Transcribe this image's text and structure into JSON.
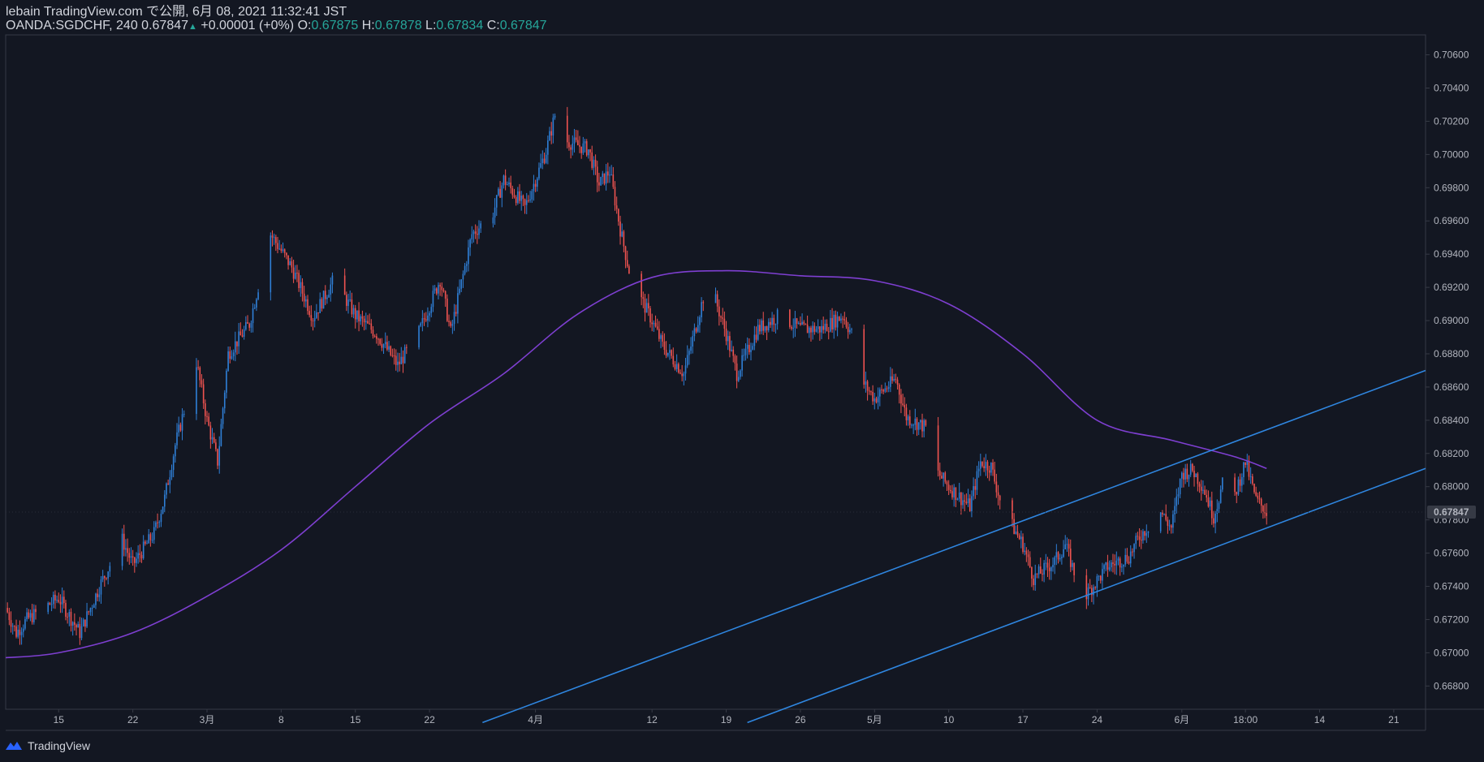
{
  "header": {
    "line1": "lebain TradingView.com で公開, 6月 08, 2021 11:32:41 JST",
    "symbol": "OANDA:SGDCHF, 240",
    "last": "0.67847",
    "change": "+0.00001 (+0%)",
    "o_label": "O:",
    "o_value": "0.67875",
    "h_label": "H:",
    "h_value": "0.67878",
    "l_label": "L:",
    "l_value": "0.67834",
    "c_label": "C:",
    "c_value": "0.67847"
  },
  "footer": {
    "brand": "TradingView"
  },
  "colors": {
    "background": "#131722",
    "up": "#2f7fd6",
    "down": "#ef5350",
    "ma": "#7e3fd1",
    "channel": "#2f86e0",
    "text": "#b2b5be",
    "green": "#26a69a"
  },
  "chart_data": {
    "type": "candlestick",
    "title": "",
    "y_axis": {
      "min": 0.6666,
      "max": 0.7072,
      "ticks": [
        "0.70600",
        "0.70400",
        "0.70200",
        "0.70000",
        "0.69800",
        "0.69600",
        "0.69400",
        "0.69200",
        "0.69000",
        "0.68800",
        "0.68600",
        "0.68400",
        "0.68200",
        "0.68000",
        "0.67800",
        "0.67600",
        "0.67400",
        "0.67200",
        "0.67000",
        "0.66800"
      ],
      "last_price_label": "0.67847",
      "last_price": 0.67847
    },
    "x_axis": {
      "start": "2021-02-10",
      "end": "2021-06-24",
      "ticks": [
        {
          "date": "2021-02-15",
          "label": "15"
        },
        {
          "date": "2021-02-22",
          "label": "22"
        },
        {
          "date": "2021-03-01",
          "label": "3月"
        },
        {
          "date": "2021-03-08",
          "label": "8"
        },
        {
          "date": "2021-03-15",
          "label": "15"
        },
        {
          "date": "2021-03-22",
          "label": "22"
        },
        {
          "date": "2021-04-01",
          "label": "4月"
        },
        {
          "date": "2021-04-12",
          "label": "12"
        },
        {
          "date": "2021-04-19",
          "label": "19"
        },
        {
          "date": "2021-04-26",
          "label": "26"
        },
        {
          "date": "2021-05-03",
          "label": "5月"
        },
        {
          "date": "2021-05-10",
          "label": "10"
        },
        {
          "date": "2021-05-17",
          "label": "17"
        },
        {
          "date": "2021-05-24",
          "label": "24"
        },
        {
          "date": "2021-06-01",
          "label": "6月"
        },
        {
          "date": "2021-06-07",
          "label": "18:00"
        },
        {
          "date": "2021-06-14",
          "label": "14"
        },
        {
          "date": "2021-06-21",
          "label": "21"
        }
      ]
    },
    "price_path": [
      {
        "t": "2021-02-10",
        "p": 0.6727
      },
      {
        "t": "2021-02-11",
        "p": 0.6712
      },
      {
        "t": "2021-02-12",
        "p": 0.672
      },
      {
        "t": "2021-02-15",
        "p": 0.6733
      },
      {
        "t": "2021-02-17",
        "p": 0.6712
      },
      {
        "t": "2021-02-19",
        "p": 0.6742
      },
      {
        "t": "2021-02-21",
        "p": 0.6768
      },
      {
        "t": "2021-02-22",
        "p": 0.6753
      },
      {
        "t": "2021-02-24",
        "p": 0.6772
      },
      {
        "t": "2021-02-25",
        "p": 0.6793
      },
      {
        "t": "2021-02-26",
        "p": 0.6825
      },
      {
        "t": "2021-02-28",
        "p": 0.6875
      },
      {
        "t": "2021-03-01",
        "p": 0.684
      },
      {
        "t": "2021-03-02",
        "p": 0.6815
      },
      {
        "t": "2021-03-03",
        "p": 0.688
      },
      {
        "t": "2021-03-05",
        "p": 0.6898
      },
      {
        "t": "2021-03-07",
        "p": 0.6952
      },
      {
        "t": "2021-03-09",
        "p": 0.6932
      },
      {
        "t": "2021-03-11",
        "p": 0.6902
      },
      {
        "t": "2021-03-13",
        "p": 0.6925
      },
      {
        "t": "2021-03-15",
        "p": 0.6903
      },
      {
        "t": "2021-03-17",
        "p": 0.6892
      },
      {
        "t": "2021-03-19",
        "p": 0.6873
      },
      {
        "t": "2021-03-21",
        "p": 0.6893
      },
      {
        "t": "2021-03-23",
        "p": 0.6925
      },
      {
        "t": "2021-03-24",
        "p": 0.6893
      },
      {
        "t": "2021-03-26",
        "p": 0.6952
      },
      {
        "t": "2021-03-28",
        "p": 0.6965
      },
      {
        "t": "2021-03-29",
        "p": 0.6985
      },
      {
        "t": "2021-03-31",
        "p": 0.6968
      },
      {
        "t": "2021-04-02",
        "p": 0.7002
      },
      {
        "t": "2021-04-03",
        "p": 0.7028
      },
      {
        "t": "2021-04-04",
        "p": 0.7008
      },
      {
        "t": "2021-04-06",
        "p": 0.7003
      },
      {
        "t": "2021-04-07",
        "p": 0.6982
      },
      {
        "t": "2021-04-08",
        "p": 0.699
      },
      {
        "t": "2021-04-09",
        "p": 0.6955
      },
      {
        "t": "2021-04-10",
        "p": 0.6925
      },
      {
        "t": "2021-04-12",
        "p": 0.69
      },
      {
        "t": "2021-04-13",
        "p": 0.6885
      },
      {
        "t": "2021-04-15",
        "p": 0.6868
      },
      {
        "t": "2021-04-17",
        "p": 0.6918
      },
      {
        "t": "2021-04-18",
        "p": 0.6912
      },
      {
        "t": "2021-04-19",
        "p": 0.6892
      },
      {
        "t": "2021-04-20",
        "p": 0.6868
      },
      {
        "t": "2021-04-22",
        "p": 0.6895
      },
      {
        "t": "2021-04-24",
        "p": 0.6903
      },
      {
        "t": "2021-04-26",
        "p": 0.6895
      },
      {
        "t": "2021-04-28",
        "p": 0.6895
      },
      {
        "t": "2021-04-30",
        "p": 0.6903
      },
      {
        "t": "2021-05-01",
        "p": 0.689
      },
      {
        "t": "2021-05-02",
        "p": 0.6862
      },
      {
        "t": "2021-05-03",
        "p": 0.6853
      },
      {
        "t": "2021-05-05",
        "p": 0.6865
      },
      {
        "t": "2021-05-06",
        "p": 0.6842
      },
      {
        "t": "2021-05-08",
        "p": 0.6835
      },
      {
        "t": "2021-05-09",
        "p": 0.6808
      },
      {
        "t": "2021-05-10",
        "p": 0.68
      },
      {
        "t": "2021-05-12",
        "p": 0.6788
      },
      {
        "t": "2021-05-13",
        "p": 0.6815
      },
      {
        "t": "2021-05-14",
        "p": 0.6812
      },
      {
        "t": "2021-05-15",
        "p": 0.6788
      },
      {
        "t": "2021-05-17",
        "p": 0.6765
      },
      {
        "t": "2021-05-18",
        "p": 0.6745
      },
      {
        "t": "2021-05-20",
        "p": 0.6755
      },
      {
        "t": "2021-05-21",
        "p": 0.6765
      },
      {
        "t": "2021-05-22",
        "p": 0.6745
      },
      {
        "t": "2021-05-23",
        "p": 0.6735
      },
      {
        "t": "2021-05-25",
        "p": 0.6752
      },
      {
        "t": "2021-05-27",
        "p": 0.6758
      },
      {
        "t": "2021-05-28",
        "p": 0.677
      },
      {
        "t": "2021-05-30",
        "p": 0.6785
      },
      {
        "t": "2021-05-31",
        "p": 0.6775
      },
      {
        "t": "2021-06-01",
        "p": 0.6808
      },
      {
        "t": "2021-06-02",
        "p": 0.681
      },
      {
        "t": "2021-06-03",
        "p": 0.68
      },
      {
        "t": "2021-06-04",
        "p": 0.6782
      },
      {
        "t": "2021-06-05",
        "p": 0.6805
      },
      {
        "t": "2021-06-06",
        "p": 0.6795
      },
      {
        "t": "2021-06-07",
        "p": 0.6815
      },
      {
        "t": "2021-06-08",
        "p": 0.6792
      },
      {
        "t": "2021-06-09",
        "p": 0.6785
      }
    ],
    "moving_average": [
      {
        "t": "2021-02-10",
        "p": 0.6697
      },
      {
        "t": "2021-02-15",
        "p": 0.67
      },
      {
        "t": "2021-02-22",
        "p": 0.6712
      },
      {
        "t": "2021-03-01",
        "p": 0.6734
      },
      {
        "t": "2021-03-08",
        "p": 0.6762
      },
      {
        "t": "2021-03-15",
        "p": 0.68
      },
      {
        "t": "2021-03-22",
        "p": 0.6838
      },
      {
        "t": "2021-03-29",
        "p": 0.6868
      },
      {
        "t": "2021-04-05",
        "p": 0.6904
      },
      {
        "t": "2021-04-12",
        "p": 0.6926
      },
      {
        "t": "2021-04-19",
        "p": 0.693
      },
      {
        "t": "2021-04-26",
        "p": 0.6927
      },
      {
        "t": "2021-05-03",
        "p": 0.6924
      },
      {
        "t": "2021-05-10",
        "p": 0.691
      },
      {
        "t": "2021-05-17",
        "p": 0.688
      },
      {
        "t": "2021-05-24",
        "p": 0.684
      },
      {
        "t": "2021-05-31",
        "p": 0.6828
      },
      {
        "t": "2021-06-06",
        "p": 0.6818
      },
      {
        "t": "2021-06-09",
        "p": 0.6811
      }
    ],
    "channel_lines": [
      {
        "start": {
          "t": "2021-03-27",
          "p": 0.6658
        },
        "end": {
          "t": "2021-06-24",
          "p": 0.687
        }
      },
      {
        "start": {
          "t": "2021-04-21",
          "p": 0.6658
        },
        "end": {
          "t": "2021-06-24",
          "p": 0.6811
        }
      }
    ]
  }
}
